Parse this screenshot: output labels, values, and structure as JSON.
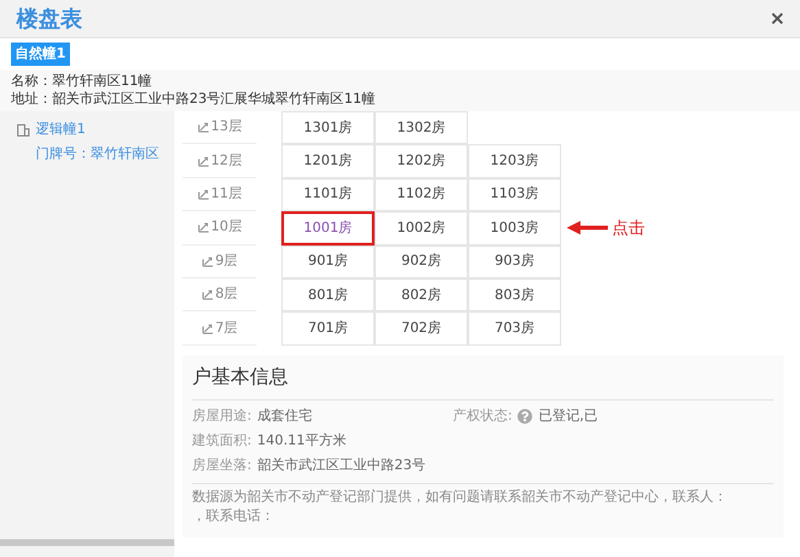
{
  "window": {
    "title": "楼盘表"
  },
  "tabs": [
    {
      "label": "自然幢1",
      "selected": true
    }
  ],
  "building": {
    "name": "名称：翠竹轩南区11幢",
    "address": "地址：韶关市武江区工业中路23号汇展华城翠竹轩南区11幢"
  },
  "sidebar": {
    "items": [
      {
        "label": "逻辑幢1",
        "children": [
          {
            "label": "门牌号：翠竹轩南区"
          }
        ]
      }
    ]
  },
  "floors": [
    {
      "label": "13层",
      "rooms": [
        {
          "label": "1301房",
          "selected": false
        },
        {
          "label": "1302房",
          "selected": false
        }
      ]
    },
    {
      "label": "12层",
      "rooms": [
        {
          "label": "1201房",
          "selected": false
        },
        {
          "label": "1202房",
          "selected": false
        },
        {
          "label": "1203房",
          "selected": false
        }
      ]
    },
    {
      "label": "11层",
      "rooms": [
        {
          "label": "1101房",
          "selected": false
        },
        {
          "label": "1102房",
          "selected": false
        },
        {
          "label": "1103房",
          "selected": false
        }
      ]
    },
    {
      "label": "10层",
      "rooms": [
        {
          "label": "1001房",
          "selected": true
        },
        {
          "label": "1002房",
          "selected": false
        },
        {
          "label": "1003房",
          "selected": false
        }
      ]
    },
    {
      "label": "9层",
      "rooms": [
        {
          "label": "901房",
          "selected": false
        },
        {
          "label": "902房",
          "selected": false
        },
        {
          "label": "903房",
          "selected": false
        }
      ]
    },
    {
      "label": "8层",
      "rooms": [
        {
          "label": "801房",
          "selected": false
        },
        {
          "label": "802房",
          "selected": false
        },
        {
          "label": "803房",
          "selected": false
        }
      ]
    },
    {
      "label": "7层",
      "rooms": [
        {
          "label": "701房",
          "selected": false
        },
        {
          "label": "702房",
          "selected": false
        },
        {
          "label": "703房",
          "selected": false
        }
      ]
    }
  ],
  "annotation": {
    "text": "点击"
  },
  "info": {
    "title": "户基本信息",
    "fields": [
      {
        "label": "房屋用途:",
        "value": "成套住宅"
      },
      {
        "label": "产权状态:",
        "value": "已登记,已"
      },
      {
        "label": "建筑面积:",
        "value": "140.11平方米"
      },
      {
        "label": "房屋坐落:",
        "value": "韶关市武江区工业中路23号"
      }
    ],
    "note": "数据源为韶关市不动产登记部门提供，如有问题请联系韶关市不动产登记中心，联系人：",
    "note_2": "，联系电话："
  }
}
